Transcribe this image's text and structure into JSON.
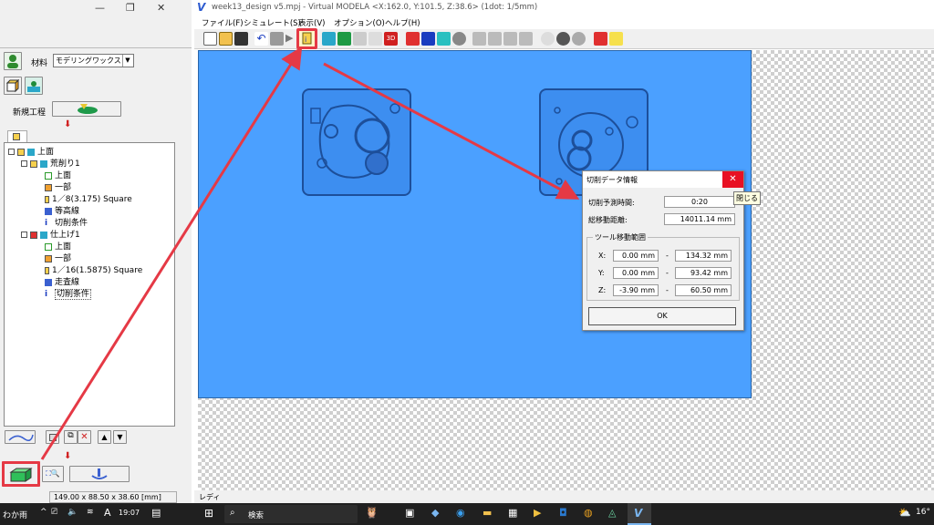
{
  "left": {
    "material_label": "材料",
    "material_value": "モデリングワックス",
    "new_process_label": "新規工程",
    "tree": [
      {
        "label": "上面",
        "level": 0
      },
      {
        "label": "荒削り1",
        "level": 1
      },
      {
        "label": "上面",
        "level": 2
      },
      {
        "label": "一部",
        "level": 2
      },
      {
        "label": "1／8(3.175) Square",
        "level": 2
      },
      {
        "label": "等高線",
        "level": 2
      },
      {
        "label": "切削条件",
        "level": 2
      },
      {
        "label": "仕上げ1",
        "level": 1
      },
      {
        "label": "上面",
        "level": 2
      },
      {
        "label": "一部",
        "level": 2
      },
      {
        "label": "1／16(1.5875) Square",
        "level": 2
      },
      {
        "label": "走査線",
        "level": 2
      },
      {
        "label": "切削条件",
        "level": 2
      }
    ],
    "size_readout": "149.00 x 88.50 x 38.60 [mm]"
  },
  "main": {
    "title": "week13_design v5.mpj - Virtual MODELA <X:162.0, Y:101.5, Z:38.6> (1dot: 1/5mm)",
    "menu": [
      "ファイル(F)",
      "シミュレート(S)",
      "表示(V)",
      "オプション(O)",
      "ヘルプ(H)"
    ],
    "status": "レディ"
  },
  "dialog": {
    "title": "切削データ情報",
    "tooltip": "閉じる",
    "est_time_label": "切削予測時間:",
    "est_time_value": "0:20",
    "total_dist_label": "総移動距離:",
    "total_dist_value": "14011.14 mm",
    "range_group": "ツール移動範囲",
    "x_label": "X:",
    "x_min": "0.00 mm",
    "x_max": "134.32 mm",
    "y_label": "Y:",
    "y_min": "0.00 mm",
    "y_max": "93.42 mm",
    "z_label": "Z:",
    "z_min": "-3.90 mm",
    "z_max": "60.50 mm",
    "dash": "-",
    "ok_label": "OK"
  },
  "taskbar": {
    "weather_left": "わか雨",
    "ime": "A",
    "time": "19:07",
    "search_label": "検索",
    "temp_right": "16°"
  },
  "colors": {
    "work_area": "#4ba0ff",
    "highlight": "#e53945",
    "dialog_close": "#e81123"
  }
}
